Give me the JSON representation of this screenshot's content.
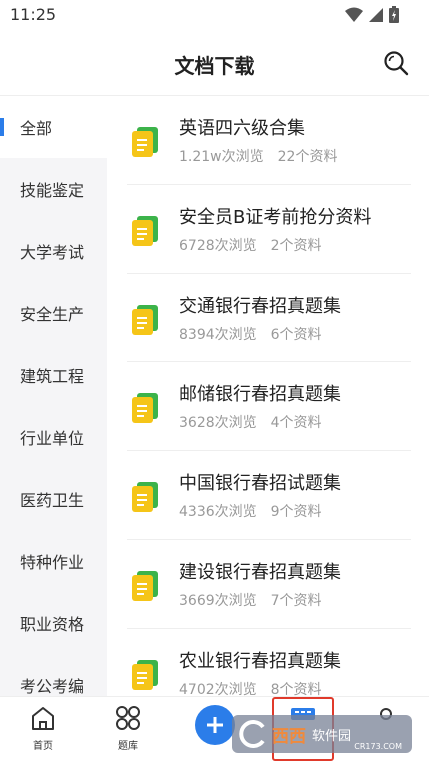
{
  "status_bar": {
    "time": "11:25"
  },
  "header": {
    "title": "文档下载"
  },
  "sidebar": {
    "items": [
      {
        "label": "全部",
        "active": true
      },
      {
        "label": "技能鉴定"
      },
      {
        "label": "大学考试"
      },
      {
        "label": "安全生产"
      },
      {
        "label": "建筑工程"
      },
      {
        "label": "行业单位"
      },
      {
        "label": "医药卫生"
      },
      {
        "label": "特种作业"
      },
      {
        "label": "职业资格"
      },
      {
        "label": "考公考编"
      }
    ]
  },
  "list": {
    "items": [
      {
        "title": "英语四六级合集",
        "views": "1.21w次浏览",
        "count": "22个资料"
      },
      {
        "title": "安全员B证考前抢分资料",
        "views": "6728次浏览",
        "count": "2个资料"
      },
      {
        "title": "交通银行春招真题集",
        "views": "8394次浏览",
        "count": "6个资料"
      },
      {
        "title": "邮储银行春招真题集",
        "views": "3628次浏览",
        "count": "4个资料"
      },
      {
        "title": "中国银行春招试题集",
        "views": "4336次浏览",
        "count": "9个资料"
      },
      {
        "title": "建设银行春招真题集",
        "views": "3669次浏览",
        "count": "7个资料"
      },
      {
        "title": "农业银行春招真题集",
        "views": "4702次浏览",
        "count": "8个资料"
      }
    ]
  },
  "bottom_nav": {
    "home_label": "首页",
    "bank_label": "题库"
  },
  "watermark": {
    "text": "西西",
    "small": "软件园",
    "url": "CR173.COM"
  },
  "colors": {
    "accent": "#2b7de9",
    "doc_icon_yellow": "#f5c518",
    "doc_icon_green": "#3cb34a",
    "highlight": "#e03a2b"
  }
}
